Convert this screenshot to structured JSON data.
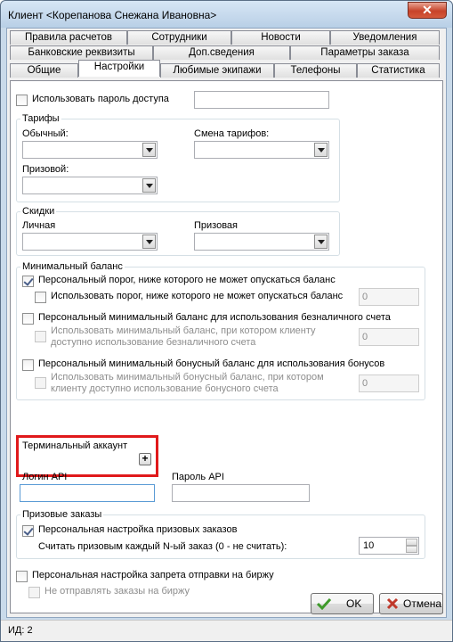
{
  "window": {
    "title": "Клиент <Корепанова Снежана Ивановна>",
    "close_label": "✕"
  },
  "tabs": {
    "row1": [
      "Правила расчетов",
      "Сотрудники",
      "Новости",
      "Уведомления"
    ],
    "row2": [
      "Банковские реквизиты",
      "Доп.сведения",
      "Параметры заказа"
    ],
    "row3": [
      "Общие",
      "Настройки",
      "Любимые экипажи",
      "Телефоны",
      "Статистика"
    ]
  },
  "settings": {
    "use_password_label": "Использовать пароль доступа",
    "use_password_checked": false,
    "password_value": "",
    "tariffs": {
      "group_label": "Тарифы",
      "regular_label": "Обычный:",
      "regular_value": "",
      "change_label": "Смена тарифов:",
      "change_value": "",
      "prize_label": "Призовой:",
      "prize_value": ""
    },
    "discounts": {
      "group_label": "Скидки",
      "personal_label": "Личная",
      "personal_value": "",
      "prize_label": "Призовая",
      "prize_value": ""
    },
    "min_balance": {
      "group_label": "Минимальный баланс",
      "personal_threshold_label": "Персональный порог, ниже которого не может опускаться баланс",
      "personal_threshold_checked": true,
      "use_threshold_label": "Использовать порог, ниже которого не может опускаться баланс",
      "use_threshold_checked": false,
      "threshold_value": "0",
      "cashless_label": "Персональный минимальный баланс для использования безналичного счета",
      "cashless_checked": false,
      "cashless_sub_label_1": "Использовать минимальный баланс, при котором клиенту",
      "cashless_sub_label_2": "доступно использование безналичного счета",
      "cashless_value": "0",
      "bonus_label": "Персональный минимальный бонусный баланс для использования бонусов",
      "bonus_checked": false,
      "bonus_sub_label_1": "Использовать минимальный бонусный баланс, при котором",
      "bonus_sub_label_2": "клиенту доступно использование бонусного счета",
      "bonus_value": "0"
    },
    "terminal_account_label": "Терминальный аккаунт",
    "terminal_account_value": "",
    "terminal_add_label": "+",
    "api_login_label": "Логин API",
    "api_login_value": "",
    "api_password_label": "Пароль API",
    "api_password_value": "",
    "prize_orders": {
      "group_label": "Призовые заказы",
      "personal_label": "Персональная настройка призовых заказов",
      "personal_checked": true,
      "nth_label": "Считать призовым каждый N-ый заказ (0 - не считать):",
      "nth_value": "10"
    },
    "exchange_label": "Персональная настройка запрета отправки на биржу",
    "exchange_checked": false,
    "no_send_label": "Не отправлять заказы на биржу",
    "no_send_checked": false
  },
  "buttons": {
    "ok_label": "OK",
    "cancel_label": "Отмена"
  },
  "status": {
    "text": "ИД: 2"
  },
  "colors": {
    "highlight": "#e0191b",
    "ok_icon": "#3f9a2b",
    "cancel_icon": "#c0392b"
  }
}
